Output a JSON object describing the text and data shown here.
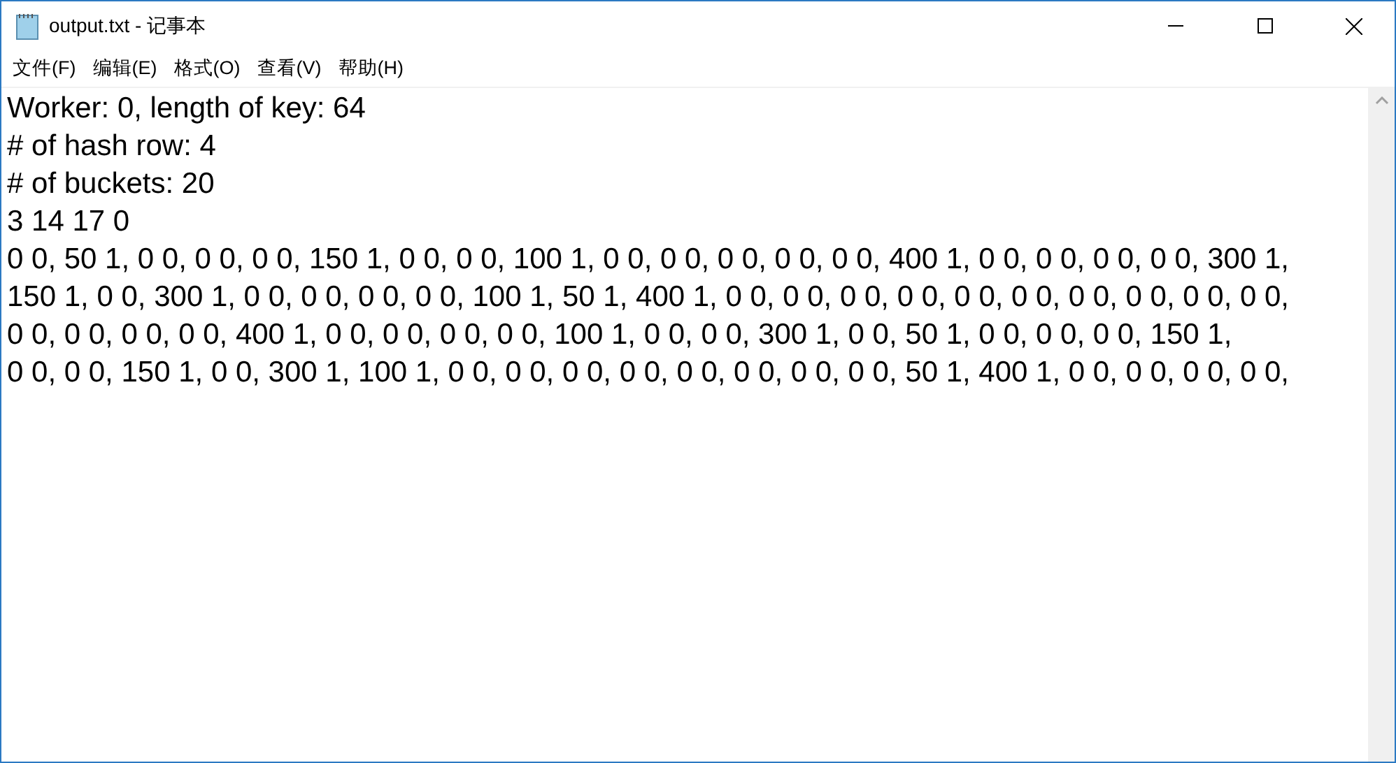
{
  "window": {
    "title": "output.txt - 记事本"
  },
  "menu": [
    "文件(F)",
    "编辑(E)",
    "格式(O)",
    "查看(V)",
    "帮助(H)"
  ],
  "lines": [
    "Worker: 0, length of key: 64",
    "# of hash row: 4",
    "# of buckets: 20",
    "3 14 17 0",
    "0 0, 50 1, 0 0, 0 0, 0 0, 150 1, 0 0, 0 0, 100 1, 0 0, 0 0, 0 0, 0 0, 0 0, 400 1, 0 0, 0 0, 0 0, 0 0, 300 1,",
    "150 1, 0 0, 300 1, 0 0, 0 0, 0 0, 0 0, 100 1, 50 1, 400 1, 0 0, 0 0, 0 0, 0 0, 0 0, 0 0, 0 0, 0 0, 0 0, 0 0,",
    "0 0, 0 0, 0 0, 0 0, 400 1, 0 0, 0 0, 0 0, 0 0, 100 1, 0 0, 0 0, 300 1, 0 0, 50 1, 0 0, 0 0, 0 0, 150 1,",
    "0 0, 0 0, 150 1, 0 0, 300 1, 100 1, 0 0, 0 0, 0 0, 0 0, 0 0, 0 0, 0 0, 0 0, 50 1, 400 1, 0 0, 0 0, 0 0, 0 0,"
  ]
}
